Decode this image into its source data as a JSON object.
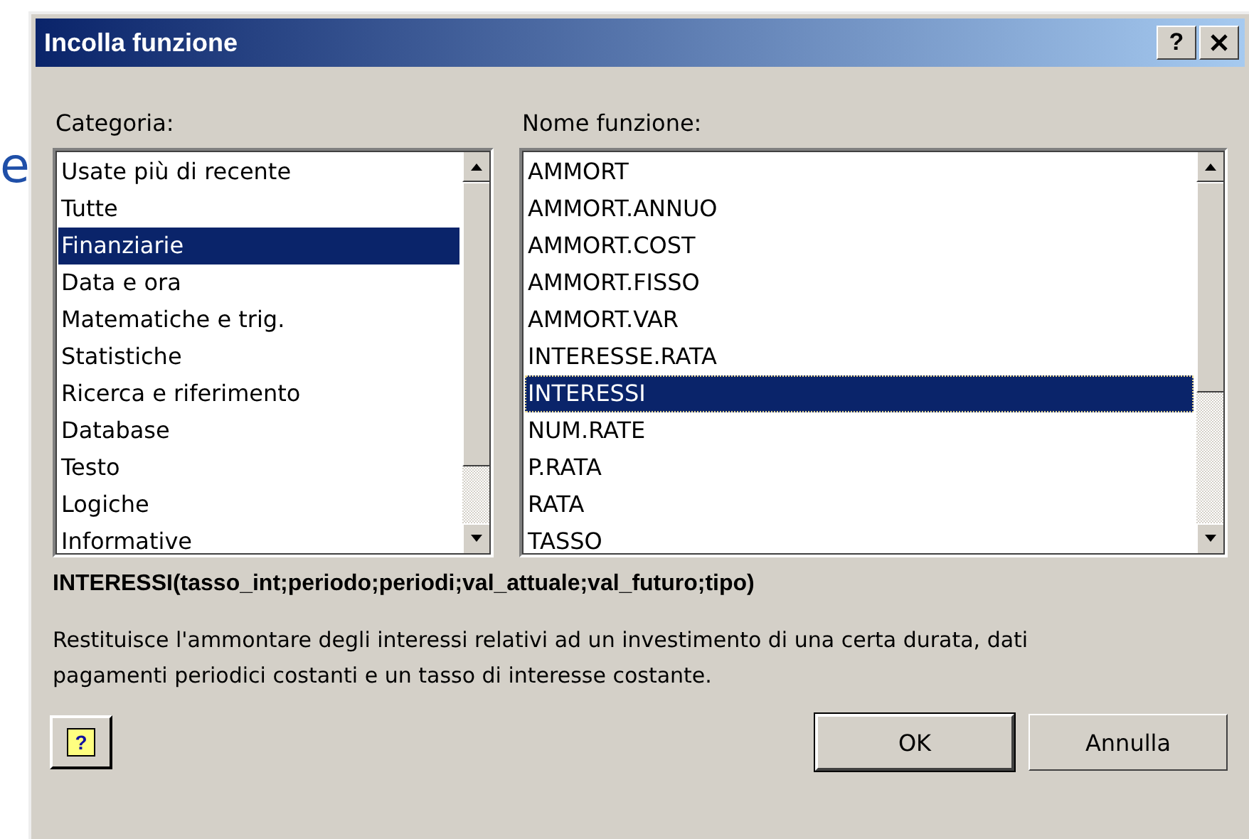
{
  "background_text": "e",
  "window": {
    "title": "Incolla funzione",
    "help_button": "?"
  },
  "categories": {
    "label": "Categoria:",
    "focused": false,
    "items": [
      {
        "label": "Usate più di recente",
        "selected": false
      },
      {
        "label": "Tutte",
        "selected": false
      },
      {
        "label": "Finanziarie",
        "selected": true
      },
      {
        "label": "Data e ora",
        "selected": false
      },
      {
        "label": "Matematiche e trig.",
        "selected": false
      },
      {
        "label": "Statistiche",
        "selected": false
      },
      {
        "label": "Ricerca e riferimento",
        "selected": false
      },
      {
        "label": "Database",
        "selected": false
      },
      {
        "label": "Testo",
        "selected": false
      },
      {
        "label": "Logiche",
        "selected": false
      },
      {
        "label": "Informative",
        "selected": false
      }
    ]
  },
  "functions": {
    "label": "Nome funzione:",
    "focused": true,
    "items": [
      {
        "label": "AMMORT",
        "selected": false
      },
      {
        "label": "AMMORT.ANNUO",
        "selected": false
      },
      {
        "label": "AMMORT.COST",
        "selected": false
      },
      {
        "label": "AMMORT.FISSO",
        "selected": false
      },
      {
        "label": "AMMORT.VAR",
        "selected": false
      },
      {
        "label": "INTERESSE.RATA",
        "selected": false
      },
      {
        "label": "INTERESSI",
        "selected": true
      },
      {
        "label": "NUM.RATE",
        "selected": false
      },
      {
        "label": "P.RATA",
        "selected": false
      },
      {
        "label": "RATA",
        "selected": false
      },
      {
        "label": "TASSO",
        "selected": false
      }
    ]
  },
  "signature": "INTERESSI(tasso_int;periodo;periodi;val_attuale;val_futuro;tipo)",
  "description": "Restituisce l'ammontare degli interessi relativi ad un investimento di una certa durata, dati pagamenti periodici costanti e un tasso di interesse costante.",
  "help_icon_text": "?",
  "buttons": [
    {
      "label": "OK",
      "default": true
    },
    {
      "label": "Annulla",
      "default": false
    }
  ]
}
